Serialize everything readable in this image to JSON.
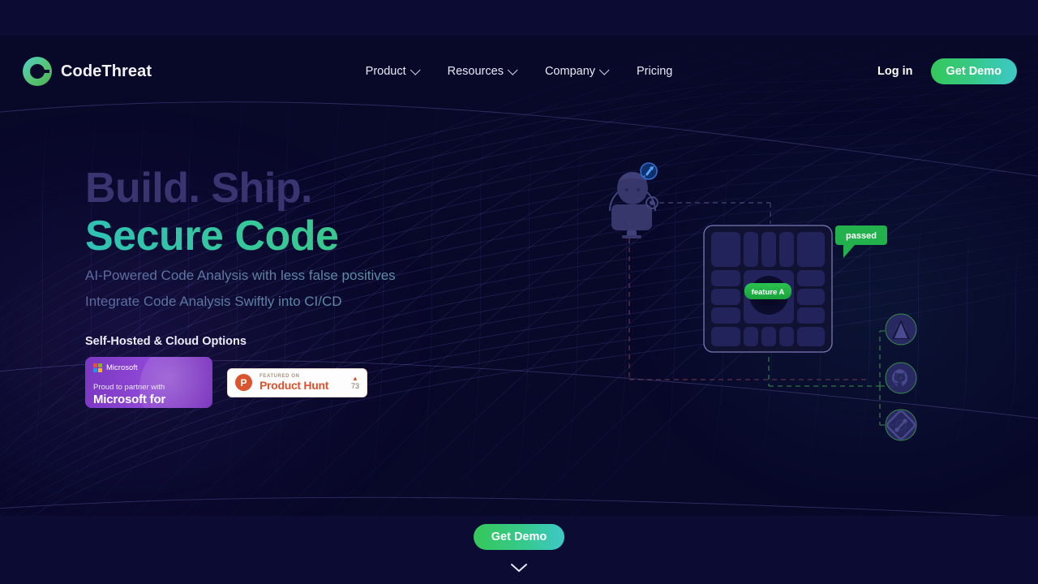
{
  "brand": {
    "name": "CodeThreat",
    "logo_icon": "codethreat-logo-icon"
  },
  "nav": {
    "items": [
      {
        "label": "Product",
        "has_dropdown": true
      },
      {
        "label": "Resources",
        "has_dropdown": true
      },
      {
        "label": "Company",
        "has_dropdown": true
      },
      {
        "label": "Pricing",
        "has_dropdown": false
      }
    ],
    "login_label": "Log in",
    "demo_label": "Get Demo"
  },
  "hero": {
    "headline_line1": "Build. Ship.",
    "headline_line2": "Secure Code",
    "subtitle_line1": "AI-Powered Code Analysis with less false positives",
    "subtitle_line2": "Integrate Code Analysis Swiftly into CI/CD",
    "self_hosted": "Self-Hosted & Cloud Options"
  },
  "badges": {
    "microsoft": {
      "word": "Microsoft",
      "sub": "Proud to partner with",
      "title": "Microsoft for Startups",
      "icon": "microsoft-logo-icon"
    },
    "product_hunt": {
      "featured": "FEATURED ON",
      "name": "Product Hunt",
      "caret": "▲",
      "count": "73",
      "icon": "product-hunt-logo-icon"
    }
  },
  "illustration": {
    "feature_label": "feature A",
    "passed_label": "passed",
    "badge_icon": "rocket-badge-icon",
    "avatar_icon": "developer-avatar-icon",
    "integrations": [
      {
        "name": "azure-devops-icon"
      },
      {
        "name": "github-icon"
      },
      {
        "name": "git-branch-icon"
      }
    ]
  },
  "bottom": {
    "demo_label": "Get Demo",
    "scroll_icon": "chevron-down-icon"
  },
  "colors": {
    "page_bg": "#080829",
    "band": "#0b0b33",
    "accent_green": "#35c759",
    "accent_teal": "#3ec8c8",
    "headline_muted": "#3a3470",
    "passed_green": "#22b14c",
    "product_hunt": "#da552f",
    "microsoft_purple": "#8e46d4"
  }
}
